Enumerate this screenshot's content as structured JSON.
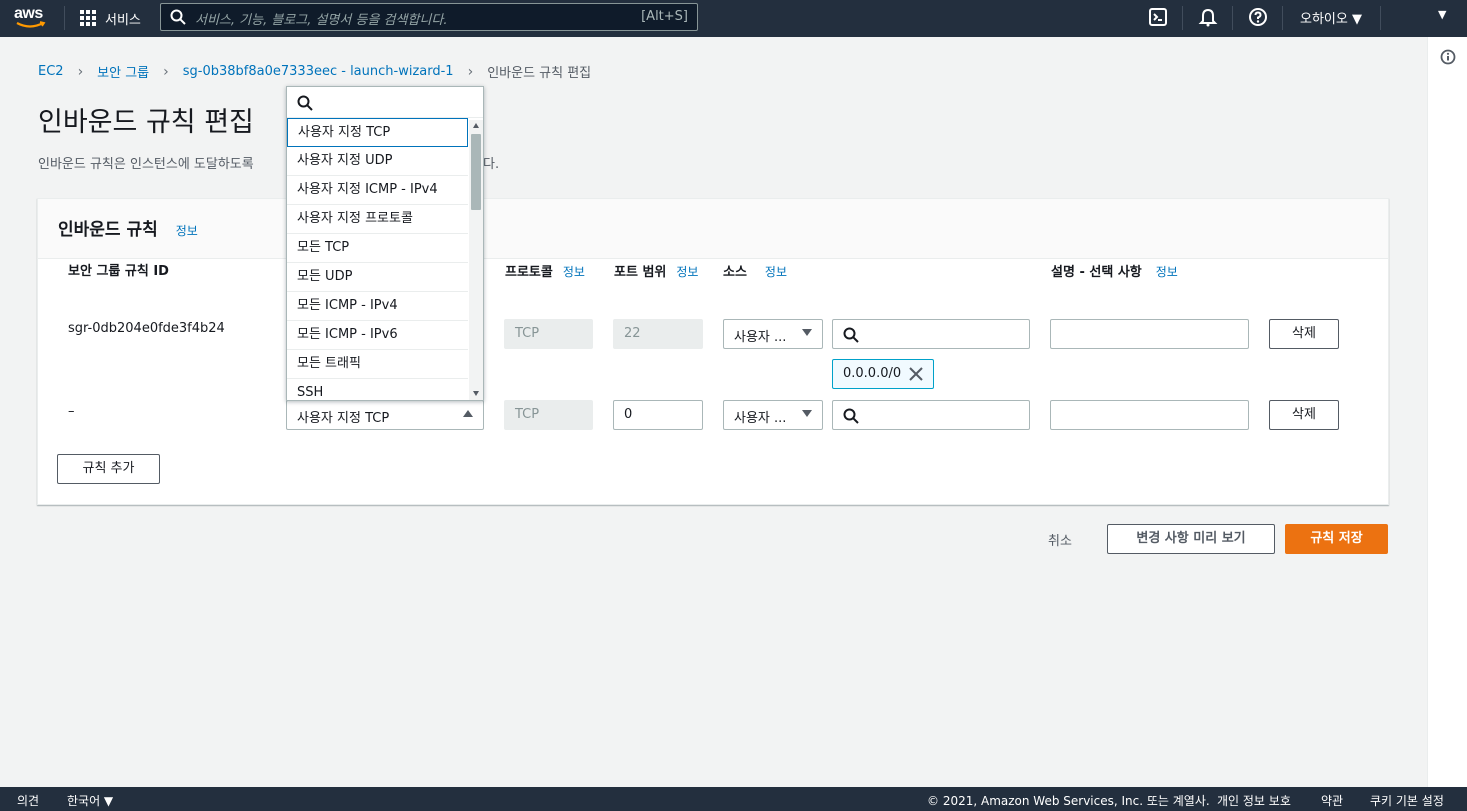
{
  "topnav": {
    "logo_text": "aws",
    "services_label": "서비스",
    "search_placeholder": "서비스, 기능, 블로그, 설명서 등을 검색합니다.",
    "search_shortcut": "[Alt+S]",
    "region": "오하이오 ▼",
    "account_arrow": "▼"
  },
  "breadcrumb": {
    "items": [
      "EC2",
      "보안 그룹",
      "sg-0b38bf8a0e7333eec - launch-wizard-1"
    ],
    "current": "인바운드 규칙 편집"
  },
  "page": {
    "title": "인바운드 규칙 편집",
    "description_start": "인바운드 규칙은 인스턴스에 도달하도록",
    "description_end": "다."
  },
  "panel": {
    "title": "인바운드 규칙",
    "info": "정보",
    "columns": {
      "rule_id": "보안 그룹 규칙 ID",
      "protocol": "프로토콜",
      "port_range": "포트 범위",
      "source": "소스",
      "description": "설명 - 선택 사항",
      "info": "정보"
    },
    "rows": [
      {
        "rule_id": "sgr-0db204e0fde3f4b24",
        "protocol": "TCP",
        "port": "22",
        "source": "사용자 ...",
        "token": "0.0.0.0/0",
        "delete": "삭제"
      },
      {
        "rule_id": "–",
        "type": "사용자 지정 TCP",
        "protocol": "TCP",
        "port": "0",
        "source": "사용자 ...",
        "delete": "삭제"
      }
    ],
    "add_rule": "규칙 추가"
  },
  "dropdown": {
    "options": [
      "사용자 지정 TCP",
      "사용자 지정 UDP",
      "사용자 지정 ICMP - IPv4",
      "사용자 지정 프로토콜",
      "모든 TCP",
      "모든 UDP",
      "모든 ICMP - IPv4",
      "모든 ICMP - IPv6",
      "모든 트래픽",
      "SSH"
    ],
    "selected_index": 0
  },
  "actions": {
    "cancel": "취소",
    "preview": "변경 사항 미리 보기",
    "save": "규칙 저장"
  },
  "footer": {
    "feedback": "의견",
    "language": "한국어 ▼",
    "copyright": "© 2021, Amazon Web Services, Inc. 또는 계열사.",
    "privacy": "개인 정보 보호",
    "terms": "약관",
    "cookies": "쿠키 기본 설정"
  }
}
